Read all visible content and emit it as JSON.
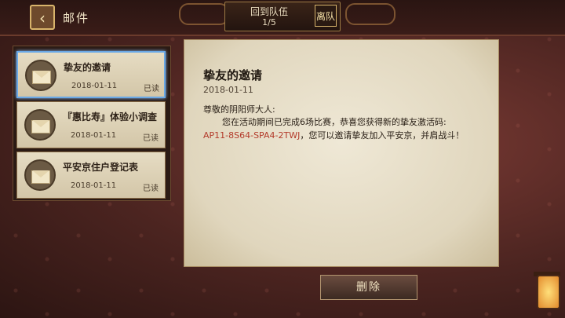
{
  "header": {
    "back_icon": "chevron-left-icon",
    "title": "邮件",
    "team": {
      "label": "回到队伍",
      "count": "1/5",
      "leave_button": "离队"
    }
  },
  "mail_list": [
    {
      "subject": "挚友的邀请",
      "date": "2018-01-11",
      "status": "已读",
      "selected": true
    },
    {
      "subject": "『惠比寿』体验小调查",
      "date": "2018-01-11",
      "status": "已读",
      "selected": false
    },
    {
      "subject": "平安京住户登记表",
      "date": "2018-01-11",
      "status": "已读",
      "selected": false
    }
  ],
  "mail_detail": {
    "title": "挚友的邀请",
    "date": "2018-01-11",
    "greeting": "尊敬的阴阳师大人:",
    "body_part1": "您在活动期间已完成6场比赛，恭喜您获得新的挚友激活码:",
    "code": "AP11-8S64-SPA4-2TWJ",
    "body_part2": "，您可以邀请挚友加入平安京，并肩战斗！"
  },
  "actions": {
    "delete_label": "删除"
  },
  "colors": {
    "selected_border": "#6aa8e6",
    "code_text": "#b33a2a"
  }
}
